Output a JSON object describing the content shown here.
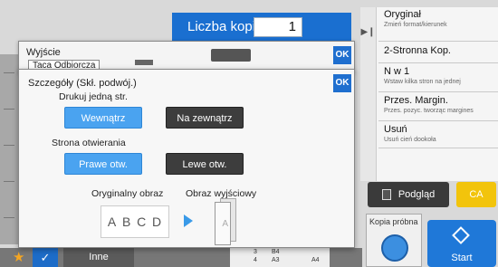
{
  "header": {
    "copies_label": "Liczba kopii",
    "copies_value": "1"
  },
  "right_menu": {
    "items": [
      {
        "title": "Oryginał",
        "subtitle": "Zmień format/kierunek"
      },
      {
        "title": "2-Stronna Kop.",
        "subtitle": ""
      },
      {
        "title": "N w 1",
        "subtitle": "Wstaw kilka stron na jednej"
      },
      {
        "title": "Przes. Margin.",
        "subtitle": "Przes. pozyc. tworząc margines"
      },
      {
        "title": "Usuń",
        "subtitle": "Usuń cień dookoła"
      }
    ]
  },
  "actions": {
    "preview_label": "Podgląd",
    "ca_label": "CA",
    "proof_label": "Kopia próbna",
    "start_label": "Start"
  },
  "output_dialog": {
    "title": "Wyjście",
    "value": "Taca Odbiorcza",
    "ok_label": "OK"
  },
  "detail_dialog": {
    "title": "Szczegóły (Skł. podwój.)",
    "ok_label": "OK",
    "print_one_side_label": "Drukuj jedną str.",
    "inside_label": "Wewnątrz",
    "outside_label": "Na zewnątrz",
    "opening_side_label": "Strona otwierania",
    "right_open_label": "Prawe otw.",
    "left_open_label": "Lewe otw.",
    "original_image_label": "Oryginalny obraz",
    "output_image_label": "Obraz wyjściowy",
    "original_letters": [
      "A",
      "B",
      "C",
      "D"
    ],
    "output_page_letter": "A",
    "selected": {
      "print_side": "Wewnątrz",
      "opening": "Prawe otw."
    }
  },
  "bottom_bar": {
    "other_label": "Inne",
    "tray_rows": [
      {
        "num": "3",
        "size": "B4"
      },
      {
        "num": "4",
        "size": "A3"
      }
    ],
    "tray_extra": "A4"
  },
  "colors": {
    "accent_blue": "#1f6fcf",
    "selected_option": "#4aa3f0",
    "ca_yellow": "#f2c40c",
    "start_blue": "#1f78d8"
  }
}
